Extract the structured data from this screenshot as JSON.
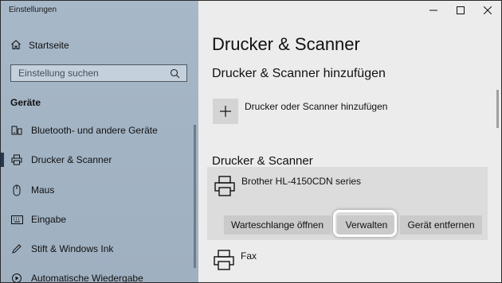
{
  "window": {
    "title": "Einstellungen"
  },
  "controls": {
    "minimize": "minimize-icon",
    "maximize": "maximize-icon",
    "close": "close-icon"
  },
  "sidebar": {
    "home_label": "Startseite",
    "search_placeholder": "Einstellung suchen",
    "section_title": "Geräte",
    "items": [
      {
        "label": "Bluetooth- und andere Geräte",
        "icon": "bluetooth-devices-icon"
      },
      {
        "label": "Drucker & Scanner",
        "icon": "printer-icon",
        "active": true
      },
      {
        "label": "Maus",
        "icon": "mouse-icon"
      },
      {
        "label": "Eingabe",
        "icon": "keyboard-icon"
      },
      {
        "label": "Stift & Windows Ink",
        "icon": "pen-icon"
      },
      {
        "label": "Automatische Wiedergabe",
        "icon": "autoplay-icon"
      }
    ]
  },
  "main": {
    "title": "Drucker & Scanner",
    "add_heading": "Drucker & Scanner hinzufügen",
    "add_button_label": "Drucker oder Scanner hinzufügen",
    "list_heading": "Drucker & Scanner",
    "printers": [
      {
        "name": "Brother HL-4150CDN series"
      },
      {
        "name": "Fax"
      }
    ],
    "actions": {
      "queue": "Warteschlange öffnen",
      "manage": "Verwalten",
      "remove": "Gerät entfernen"
    }
  },
  "colors": {
    "sidebar_bg": "#a3b4c4",
    "main_bg": "#ececec",
    "card_bg": "#dcdcdc",
    "button_bg": "#cacaca"
  }
}
